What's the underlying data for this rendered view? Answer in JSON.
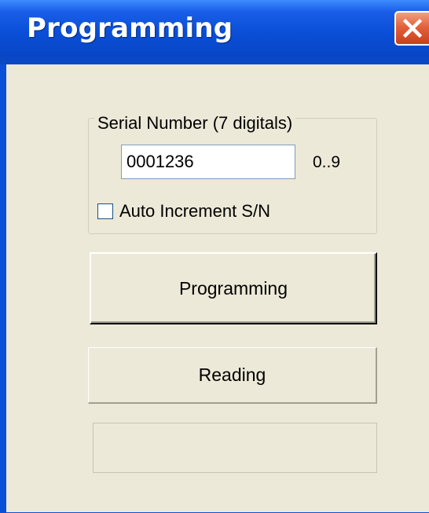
{
  "window": {
    "title": "Programming",
    "close_icon": "close-icon"
  },
  "serial_group": {
    "legend": "Serial Number (7 digitals)",
    "serial_value": "0001236",
    "range_hint": "0..9",
    "auto_increment_label": "Auto Increment S/N",
    "auto_increment_checked": false
  },
  "buttons": {
    "programming_label": "Programming",
    "reading_label": "Reading"
  },
  "status": {
    "text": ""
  },
  "colors": {
    "title_bar": "#0a4fd8",
    "close_button": "#e2623c",
    "client_background": "#ece9d8"
  }
}
